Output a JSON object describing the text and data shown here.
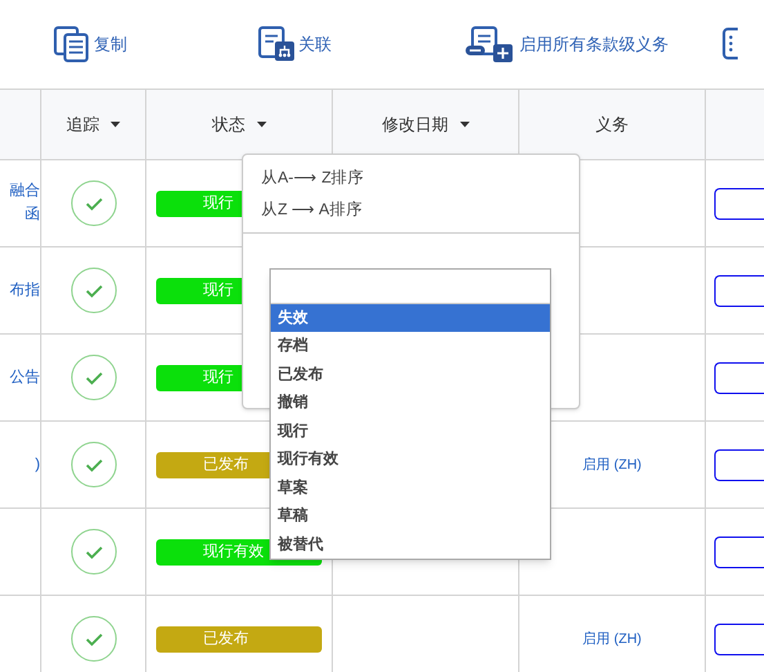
{
  "toolbar": [
    {
      "kind": "copy",
      "label": "复制"
    },
    {
      "kind": "link",
      "label": "关联"
    },
    {
      "kind": "enable",
      "label": "启用所有条款级义务"
    },
    {
      "kind": "grid"
    }
  ],
  "table": {
    "columns": [
      {
        "label": "追踪",
        "sortable": true
      },
      {
        "label": "状态",
        "sortable": true
      },
      {
        "label": "修改日期",
        "sortable": true
      },
      {
        "label": "义务",
        "sortable": false
      }
    ],
    "rows": [
      {
        "column_1": [
          "融合",
          "函"
        ],
        "tracked": true,
        "status": {
          "text": "现行",
          "color": "#0be00b"
        }
      },
      {
        "column_1": [
          "布指"
        ],
        "tracked": true,
        "status": {
          "text": "现行",
          "color": "#0be00b"
        }
      },
      {
        "column_1": [
          "公告"
        ],
        "tracked": true,
        "status": {
          "text": "现行",
          "color": "#0be00b"
        }
      },
      {
        "column_1": [
          ")"
        ],
        "tracked": true,
        "status": {
          "text": "已发布",
          "color": "#c4a912"
        },
        "obligation": "启用 (ZH)"
      },
      {
        "tracked": true,
        "status": {
          "text": "现行有效",
          "color": "#0be00b"
        }
      },
      {
        "tracked": true,
        "status": {
          "text": "已发布",
          "color": "#c4a912"
        },
        "obligation": "启用 (ZH)"
      }
    ]
  },
  "filter_popup": {
    "sort_options": [
      "从A-⟶ Z排序",
      "从Z ⟶ A排序"
    ],
    "options": [
      {
        "label": "失效",
        "selected": true
      },
      {
        "label": "存档",
        "selected": false
      },
      {
        "label": "已发布",
        "selected": false
      },
      {
        "label": "撤销",
        "selected": false
      },
      {
        "label": "现行",
        "selected": false
      },
      {
        "label": "现行有效",
        "selected": false
      },
      {
        "label": "草案",
        "selected": false
      },
      {
        "label": "草稿",
        "selected": false
      },
      {
        "label": "被替代",
        "selected": false
      }
    ]
  }
}
